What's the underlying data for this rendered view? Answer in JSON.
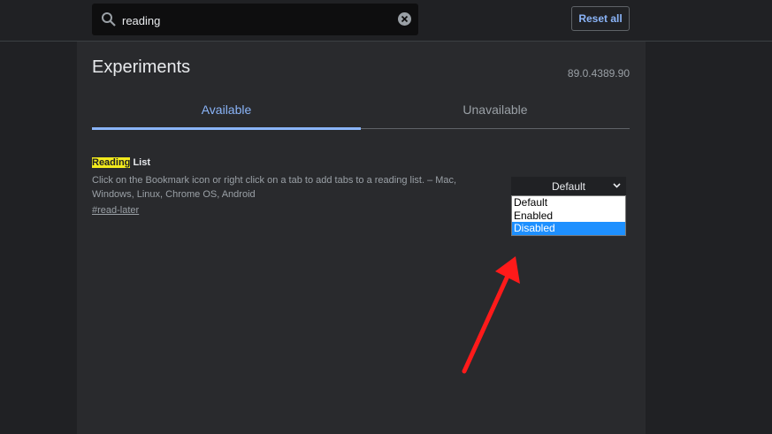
{
  "toolbar": {
    "search_value": "reading",
    "reset_label": "Reset all"
  },
  "header": {
    "title": "Experiments",
    "version": "89.0.4389.90"
  },
  "tabs": [
    {
      "label": "Available"
    },
    {
      "label": "Unavailable"
    }
  ],
  "experiment": {
    "name_highlight": "Reading",
    "name_rest": " List",
    "description": "Click on the Bookmark icon or right click on a tab to add tabs to a reading list. – Mac, Windows, Linux, Chrome OS, Android",
    "link": "#read-later",
    "select_value": "Default",
    "options": [
      "Default",
      "Enabled",
      "Disabled"
    ],
    "highlighted_option": "Disabled"
  },
  "colors": {
    "accent": "#8ab4f8",
    "highlight": "#f2ea1d",
    "annotation_arrow": "#ff1a1a",
    "option_selected": "#1e90ff"
  },
  "icons": [
    "search-icon",
    "clear-icon",
    "chevron-down-icon",
    "annotation-arrow"
  ]
}
